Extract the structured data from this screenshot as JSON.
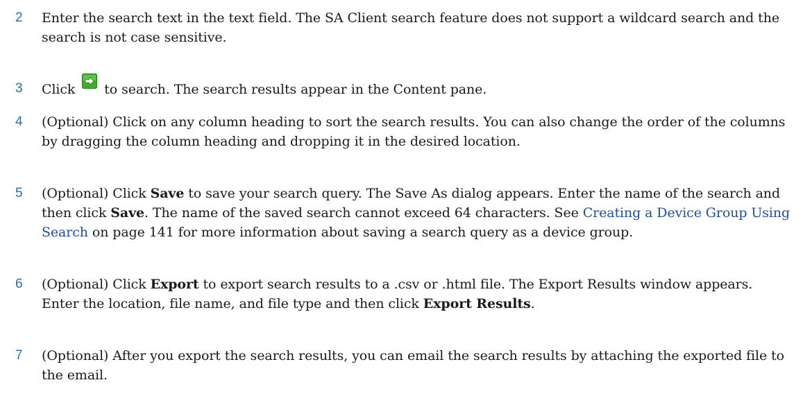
{
  "steps": [
    {
      "number": "2",
      "text": "Enter the search text in the text field. The SA Client search feature does not support a wildcard search and the search is not case sensitive."
    },
    {
      "number": "3",
      "before": "Click",
      "icon": "green-arrow-go-icon",
      "after": "to search. The search results appear in the Content pane."
    },
    {
      "number": "4",
      "text": "(Optional) Click on any column heading to sort the search results. You can also change the order of the columns by dragging the column heading and dropping it in the desired location."
    },
    {
      "number": "5",
      "t1": "(Optional) Click ",
      "b1": "Save",
      "t2": " to save your search query. The Save As dialog appears. Enter the name of the search and then click ",
      "b2": "Save",
      "t3": ". The name of the saved search cannot exceed 64 characters. See ",
      "link": "Creating a Device Group Using Search",
      "t4": " on page 141 for more information about saving a search query as a device group."
    },
    {
      "number": "6",
      "t1": "(Optional) Click ",
      "b1": "Export",
      "t2": " to export search results to a .csv or .html file. The Export Results window appears. Enter the location, file name, and file type and then click ",
      "b2": "Export Results",
      "t3": "."
    },
    {
      "number": "7",
      "text": "(Optional) After you export the search results, you can email the search results by attaching the exported file to the email."
    }
  ],
  "colors": {
    "step_number": "#2a6fb5",
    "link": "#1f4f9e",
    "icon_green": "#3fae2a"
  }
}
